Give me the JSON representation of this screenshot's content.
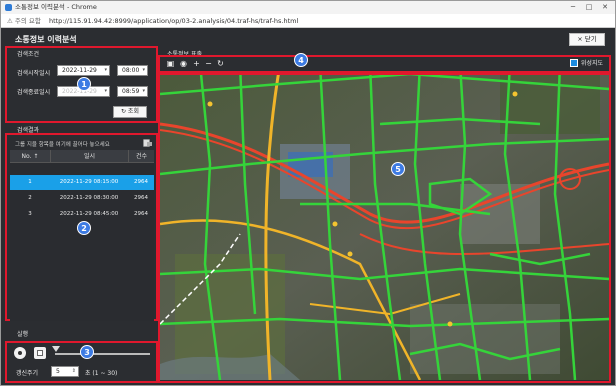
{
  "browser": {
    "window_title": "소통정보 이력분석 - Chrome",
    "address_warning": "⚠ 주의 요함",
    "url": "http://115.91.94.42:8999/application/op/03-2.analysis/04.traf-hs/traf-hs.html"
  },
  "app": {
    "title": "소통정보 이력분석",
    "close_label": "× 닫기"
  },
  "search": {
    "section_label": "검색조건",
    "start_label": "검색시작일시",
    "start_date": "2022-11-29",
    "start_time": "08:00",
    "end_label": "검색종료일시",
    "end_date": "2022-11-29",
    "end_time": "08:59",
    "lookup_label": "↻ 조회"
  },
  "results": {
    "section_label": "검색결과",
    "group_hint": "그룹 지을 항목을 여기에 끌어다 놓으세요",
    "columns": [
      "No. ↑",
      "일시",
      "건수"
    ],
    "rows": [
      {
        "no": "1",
        "datetime": "2022-11-29 08:15:00",
        "count": "2964"
      },
      {
        "no": "2",
        "datetime": "2022-11-29 08:30:00",
        "count": "2964"
      },
      {
        "no": "3",
        "datetime": "2022-11-29 08:45:00",
        "count": "2964"
      }
    ]
  },
  "map": {
    "section_label": "소통정보 표출",
    "satellite_label": "위성지도",
    "tools": [
      "save-icon",
      "globe-icon",
      "zoom-in-icon",
      "zoom-out-icon",
      "refresh-icon"
    ]
  },
  "execution": {
    "section_label": "실행",
    "interval_label": "갱신주기",
    "interval_value": "5",
    "interval_unit": "초 (1 ~ 30)"
  },
  "badges": [
    "1",
    "2",
    "3",
    "4",
    "5"
  ],
  "colors": {
    "accent": "#1aa0e8",
    "highlight_box": "#e0182d",
    "badge": "#3d7be3",
    "road_smooth": "#35d43a",
    "road_slow": "#f0b429",
    "road_congested": "#e8452c"
  }
}
